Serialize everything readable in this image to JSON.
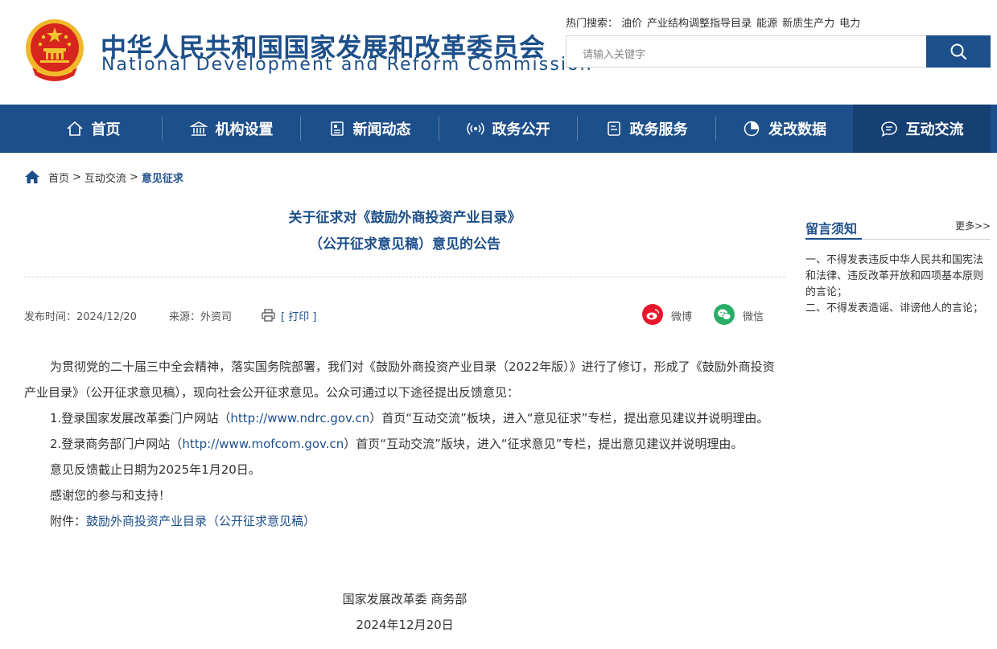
{
  "header": {
    "title_cn": "中华人民共和国国家发展和改革委员会",
    "title_en": "National Development and Reform Commission",
    "hot_label": "热门搜索：",
    "hot_terms": [
      "油价",
      "产业结构调整指导目录",
      "能源",
      "新质生产力",
      "电力"
    ],
    "search_placeholder": "请输入关键字"
  },
  "nav": {
    "items": [
      {
        "label": "首页",
        "icon": "home-icon"
      },
      {
        "label": "机构设置",
        "icon": "building-icon"
      },
      {
        "label": "新闻动态",
        "icon": "newspaper-icon"
      },
      {
        "label": "政务公开",
        "icon": "broadcast-icon"
      },
      {
        "label": "政务服务",
        "icon": "document-icon"
      },
      {
        "label": "发改数据",
        "icon": "pie-chart-icon"
      },
      {
        "label": "互动交流",
        "icon": "chat-icon"
      }
    ],
    "active": "互动交流"
  },
  "breadcrumb": {
    "items": [
      "首页",
      "互动交流",
      "意见征求"
    ],
    "separator": ">"
  },
  "article": {
    "title_line1": "关于征求对《鼓励外商投资产业目录》",
    "title_line2": "（公开征求意见稿）意见的公告",
    "publish_label": "发布时间：",
    "publish_date": "2024/12/20",
    "source_label": "来源：",
    "source": "外资司",
    "print_label": "[ 打印 ]",
    "share_weibo": "微博",
    "share_wechat": "微信",
    "para1": "为贯彻党的二十届三中全会精神，落实国务院部署，我们对《鼓励外商投资产业目录（2022年版）》进行了修订，形成了《鼓励外商投资产业目录》（公开征求意见稿），现向社会公开征求意见。公众可通过以下途径提出反馈意见：",
    "item1_pre": "1.登录国家发展改革委门户网站（",
    "item1_link": "http://www.ndrc.gov.cn",
    "item1_post": "）首页“互动交流”板块，进入“意见征求”专栏，提出意见建议并说明理由。",
    "item2_pre": "2.登录商务部门户网站（",
    "item2_link": "http://www.mofcom.gov.cn",
    "item2_post": "）首页“互动交流”版块，进入“征求意见”专栏，提出意见建议并说明理由。",
    "deadline": "意见反馈截止日期为2025年1月20日。",
    "thanks": "感谢您的参与和支持！",
    "attachment_label": "附件：",
    "attachment_link": "鼓励外商投资产业目录（公开征求意见稿）",
    "signatory": "国家发展改革委  商务部",
    "sign_date": "2024年12月20日"
  },
  "sidebar": {
    "title": "留言须知",
    "more": "更多>>",
    "rule1": "一、不得发表违反中华人民共和国宪法和法律、违反改革开放和四项基本原则的言论；",
    "rule2": "二、不得发表造谣、诽谤他人的言论；"
  },
  "colors": {
    "brand_blue": "#1d4f8a",
    "nav_active": "#163f72",
    "weibo_red": "#e6162d",
    "wechat_green": "#2aae67",
    "emblem_red": "#d7261e",
    "emblem_gold": "#f4c430"
  }
}
